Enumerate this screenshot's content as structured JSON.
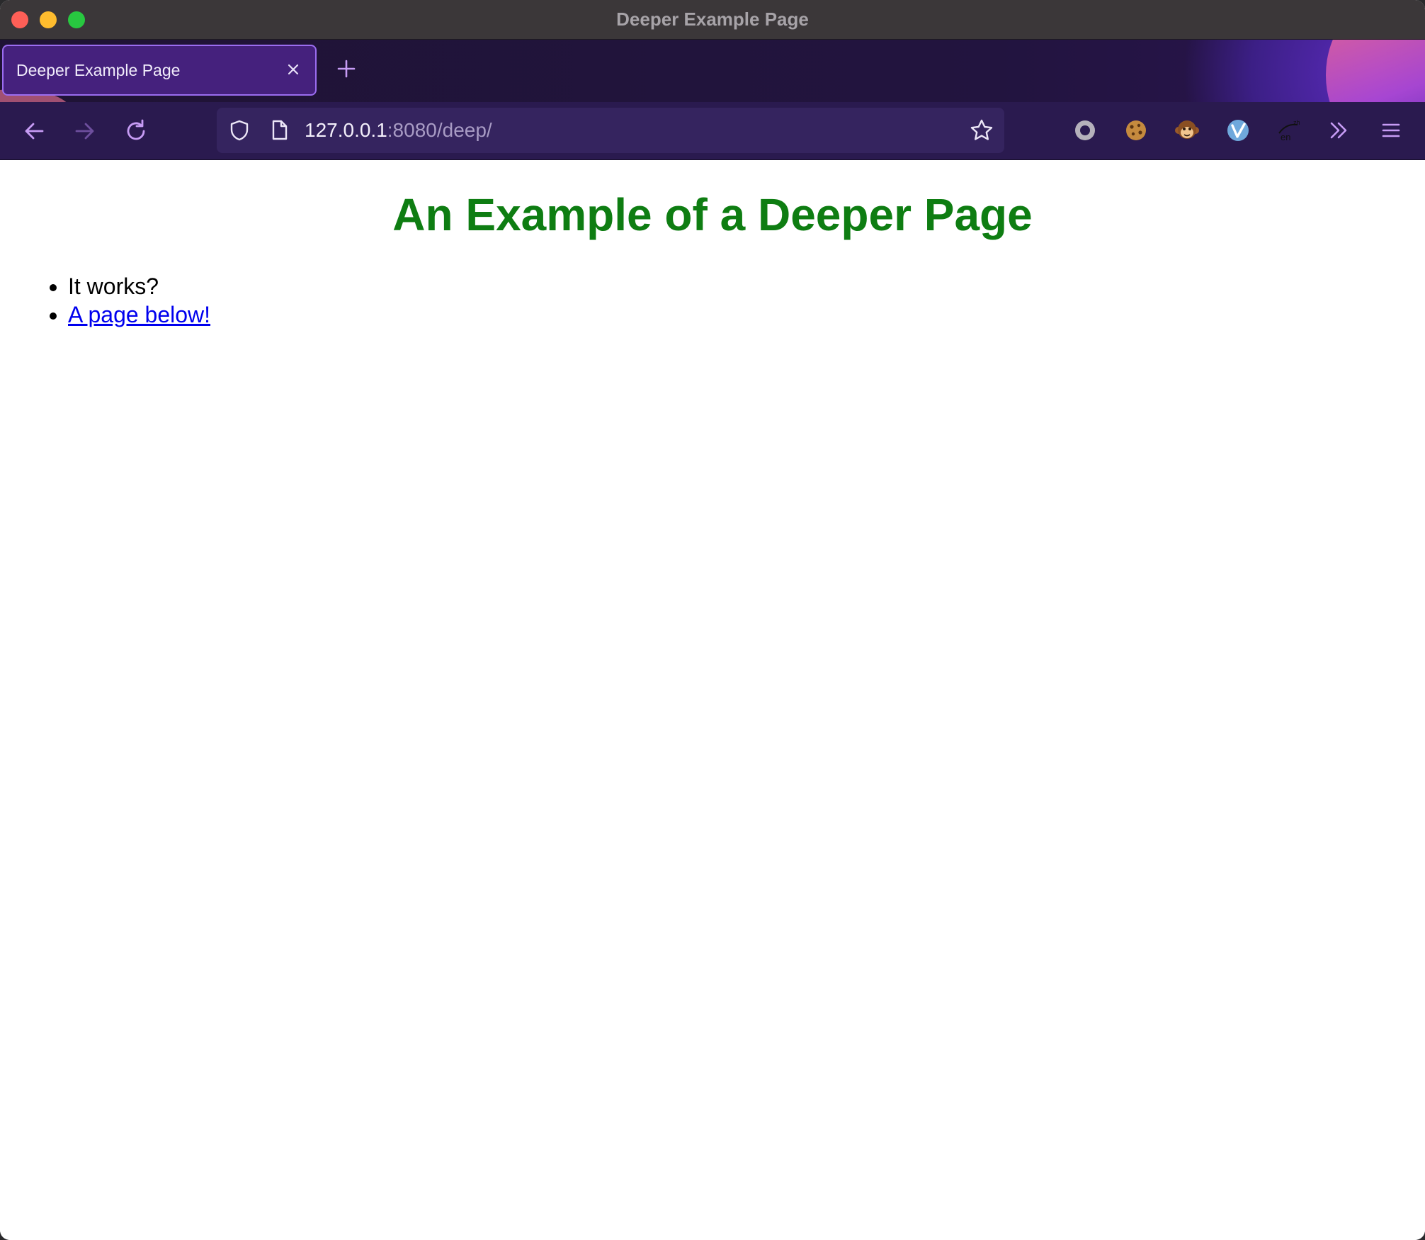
{
  "window": {
    "title": "Deeper Example Page"
  },
  "tabs": [
    {
      "label": "Deeper Example Page",
      "active": true
    }
  ],
  "address_bar": {
    "host": "127.0.0.1",
    "rest": ":8080/deep/"
  },
  "toolbar": {
    "back_icon": "arrow-left",
    "forward_icon": "arrow-right",
    "reload_icon": "reload",
    "extensions": [
      "record-icon",
      "cookie-icon",
      "monkey-icon",
      "vimium-icon",
      "translate-icon"
    ],
    "overflow_icon": "chevrons-right",
    "menu_icon": "hamburger-menu"
  },
  "content": {
    "heading": "An Example of a Deeper Page",
    "list": [
      {
        "text": "It works?",
        "link": false
      },
      {
        "text": "A page below!",
        "link": true
      }
    ]
  },
  "colors": {
    "heading": "#0e7d12",
    "link": "#0000ee",
    "toolbar_bg": "#2a1a4f",
    "tab_active_bg": "#45217d"
  }
}
